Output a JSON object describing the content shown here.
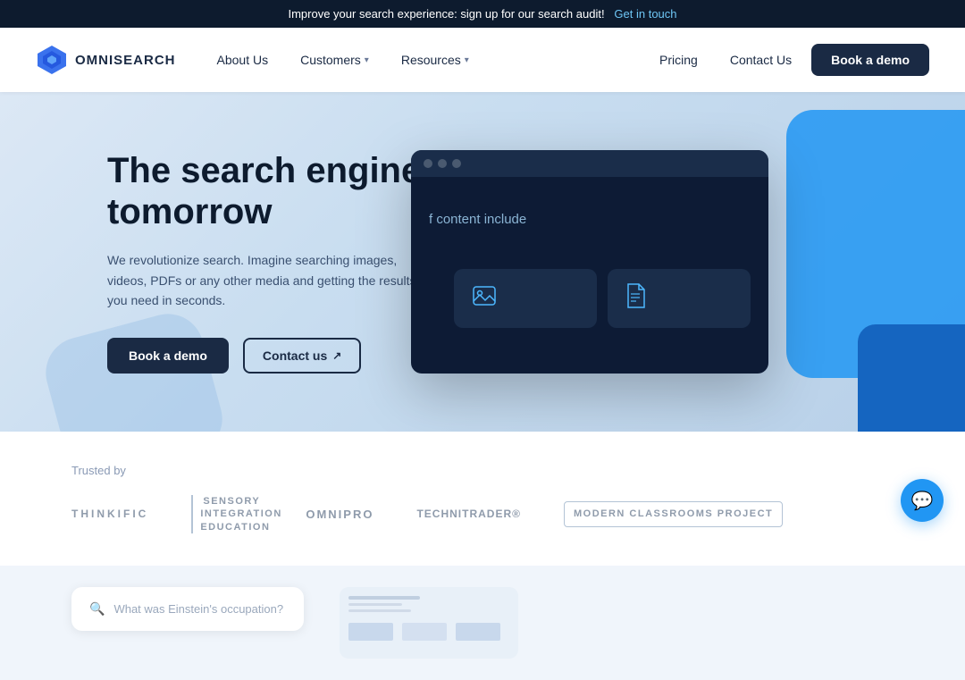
{
  "banner": {
    "text": "Improve your search experience: sign up for our search audit!",
    "cta": "Get in touch"
  },
  "nav": {
    "logo_text": "OMNISEARCH",
    "links": [
      {
        "label": "About Us",
        "has_dropdown": false
      },
      {
        "label": "Customers",
        "has_dropdown": true
      },
      {
        "label": "Resources",
        "has_dropdown": true
      }
    ],
    "right_links": [
      {
        "label": "Pricing"
      },
      {
        "label": "Contact Us"
      }
    ],
    "book_demo": "Book a demo"
  },
  "hero": {
    "title": "The search engine of tomorrow",
    "subtitle": "We revolutionize search. Imagine searching images, videos, PDFs or any other media and getting the results you need in seconds.",
    "btn_demo": "Book a demo",
    "btn_contact": "Contact us",
    "browser_content_text": "f content include"
  },
  "trusted": {
    "label": "Trusted by",
    "logos": [
      {
        "name": "thinkific",
        "text": "THINKIFIC"
      },
      {
        "name": "sensory",
        "text": "Sensory Integration Education"
      },
      {
        "name": "omnipro",
        "text": "OMNIPRO"
      },
      {
        "name": "technitrader",
        "text": "TECHNITRADER®"
      },
      {
        "name": "modern",
        "text": "Modern Classrooms Project"
      }
    ]
  },
  "search_demo": {
    "placeholder": "What was Einstein's occupation?"
  },
  "chat": {
    "icon": "💬"
  }
}
